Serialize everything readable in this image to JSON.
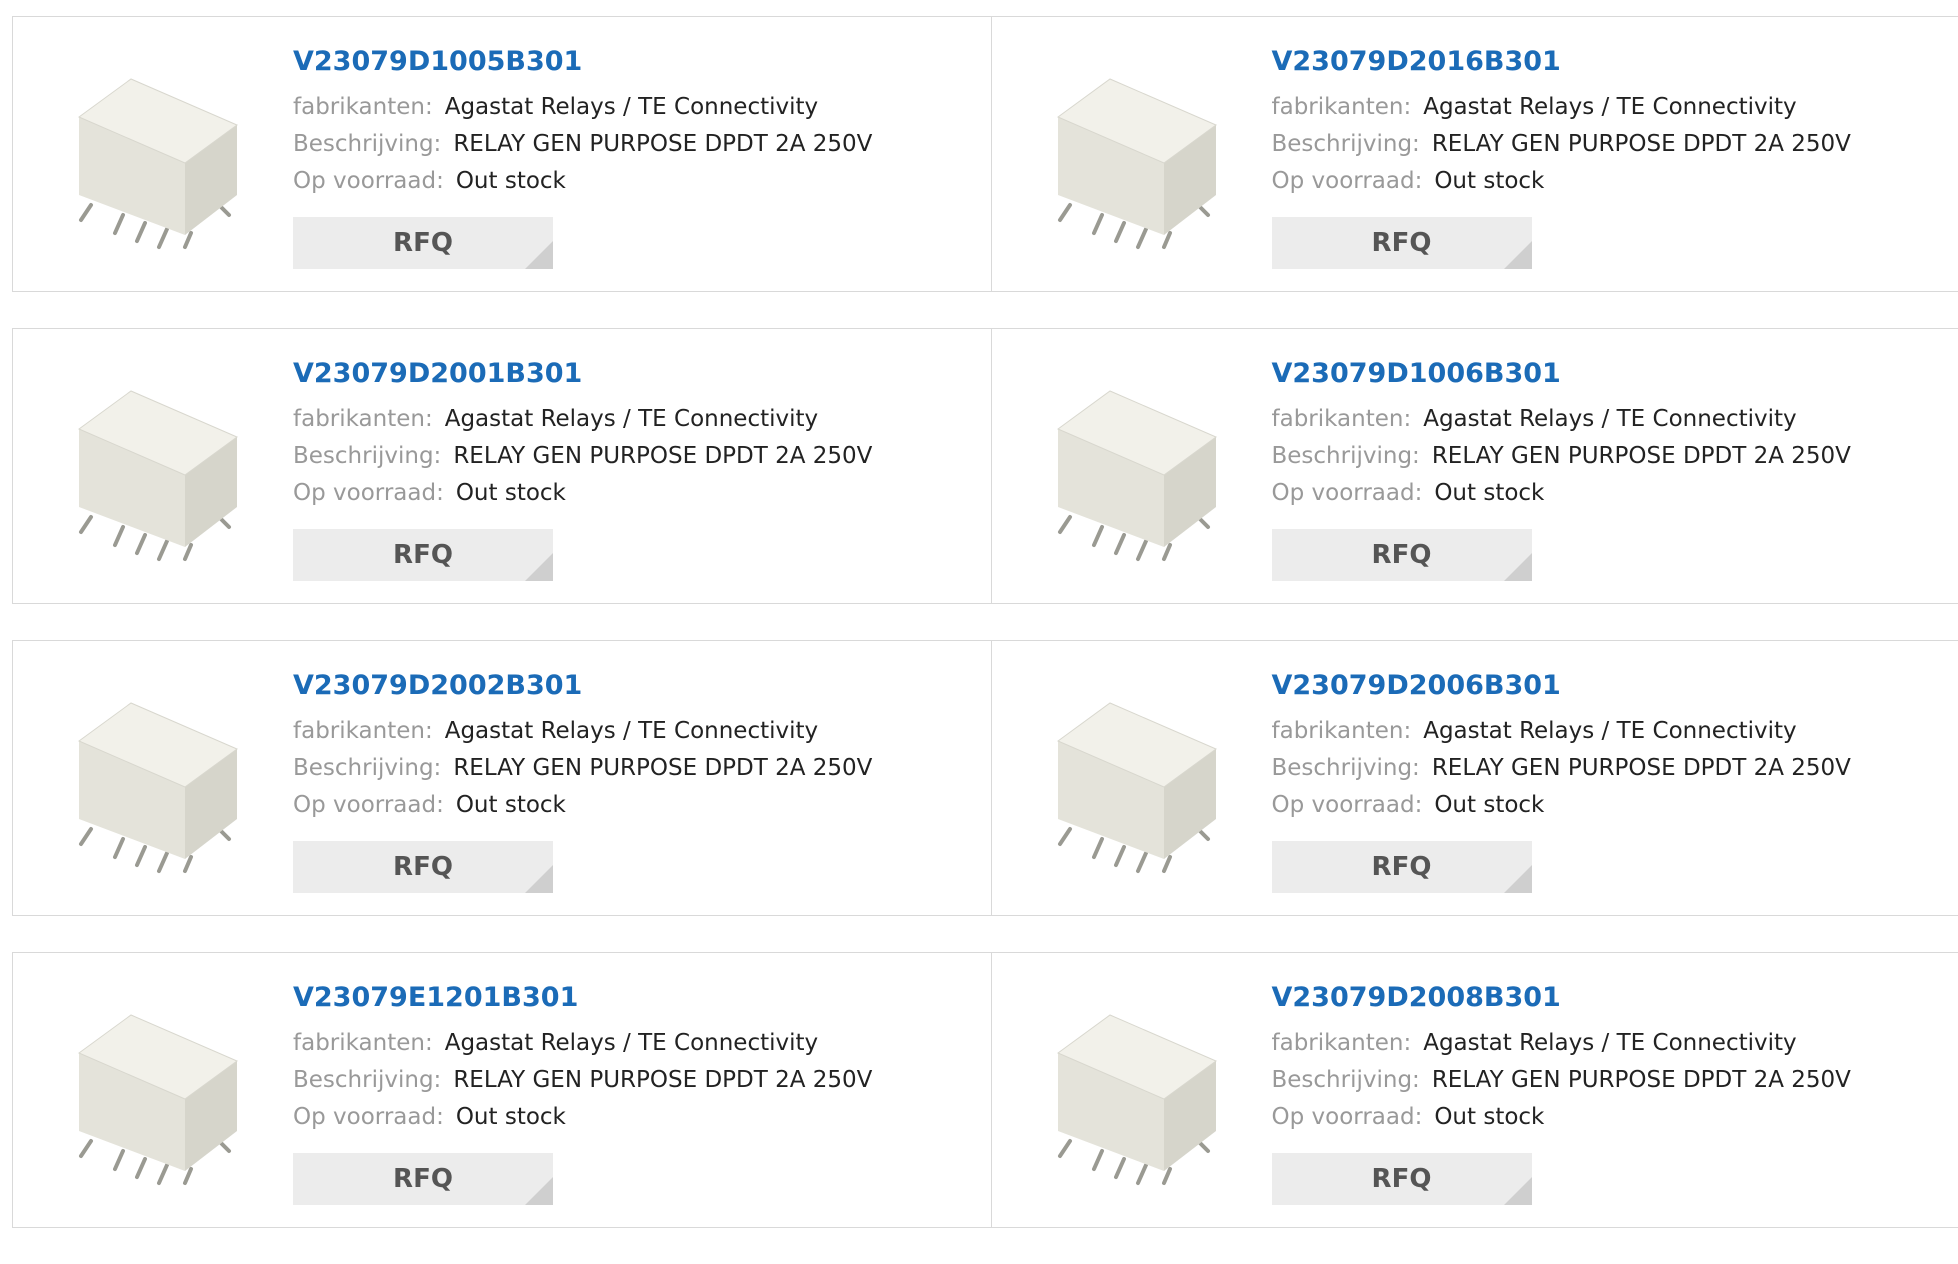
{
  "labels": {
    "manufacturer": "fabrikanten:",
    "description": "Beschrijving:",
    "stock": "Op voorraad:",
    "rfq": "RFQ"
  },
  "products": [
    {
      "part": "V23079D1005B301",
      "manufacturer": "Agastat Relays / TE Connectivity",
      "description": "RELAY GEN PURPOSE DPDT 2A 250V",
      "stock": "Out stock"
    },
    {
      "part": "V23079D2016B301",
      "manufacturer": "Agastat Relays / TE Connectivity",
      "description": "RELAY GEN PURPOSE DPDT 2A 250V",
      "stock": "Out stock"
    },
    {
      "part": "V23079D2001B301",
      "manufacturer": "Agastat Relays / TE Connectivity",
      "description": "RELAY GEN PURPOSE DPDT 2A 250V",
      "stock": "Out stock"
    },
    {
      "part": "V23079D1006B301",
      "manufacturer": "Agastat Relays / TE Connectivity",
      "description": "RELAY GEN PURPOSE DPDT 2A 250V",
      "stock": "Out stock"
    },
    {
      "part": "V23079D2002B301",
      "manufacturer": "Agastat Relays / TE Connectivity",
      "description": "RELAY GEN PURPOSE DPDT 2A 250V",
      "stock": "Out stock"
    },
    {
      "part": "V23079D2006B301",
      "manufacturer": "Agastat Relays / TE Connectivity",
      "description": "RELAY GEN PURPOSE DPDT 2A 250V",
      "stock": "Out stock"
    },
    {
      "part": "V23079E1201B301",
      "manufacturer": "Agastat Relays / TE Connectivity",
      "description": "RELAY GEN PURPOSE DPDT 2A 250V",
      "stock": "Out stock"
    },
    {
      "part": "V23079D2008B301",
      "manufacturer": "Agastat Relays / TE Connectivity",
      "description": "RELAY GEN PURPOSE DPDT 2A 250V",
      "stock": "Out stock"
    }
  ],
  "colors": {
    "link": "#1b6bb7",
    "label": "#999999",
    "value": "#222222",
    "button_bg": "#ececec",
    "border": "#d9d9d9"
  },
  "icons": {
    "product_image": "relay-photo"
  }
}
